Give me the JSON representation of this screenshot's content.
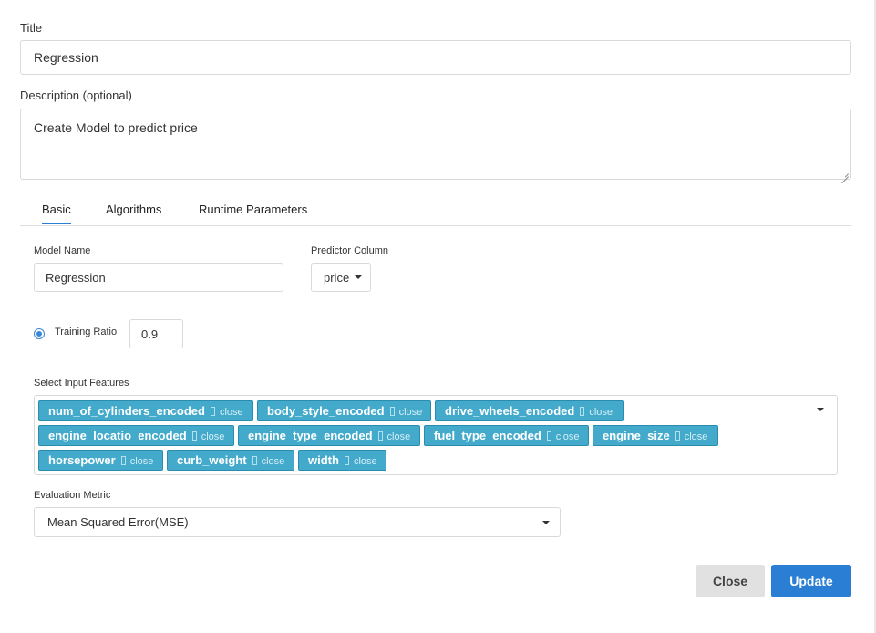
{
  "title": {
    "label": "Title",
    "value": "Regression"
  },
  "description": {
    "label": "Description (optional)",
    "value": "Create Model to predict price"
  },
  "tabs": [
    {
      "label": "Basic",
      "active": true
    },
    {
      "label": "Algorithms",
      "active": false
    },
    {
      "label": "Runtime Parameters",
      "active": false
    }
  ],
  "model_name": {
    "label": "Model Name",
    "value": "Regression"
  },
  "predictor": {
    "label": "Predictor Column",
    "value": "price"
  },
  "training_ratio": {
    "label": "Training Ratio",
    "value": "0.9",
    "selected": true
  },
  "input_features": {
    "label": "Select Input Features",
    "remove_label": "close",
    "tags": [
      "num_of_cylinders_encoded",
      "body_style_encoded",
      "drive_wheels_encoded",
      "engine_locatio_encoded",
      "engine_type_encoded",
      "fuel_type_encoded",
      "engine_size",
      "horsepower",
      "curb_weight",
      "width"
    ]
  },
  "evaluation_metric": {
    "label": "Evaluation Metric",
    "value": "Mean Squared Error(MSE)"
  },
  "buttons": {
    "close": "Close",
    "update": "Update"
  },
  "colors": {
    "accent": "#2a7fd4",
    "tag_bg": "#44aacb"
  }
}
